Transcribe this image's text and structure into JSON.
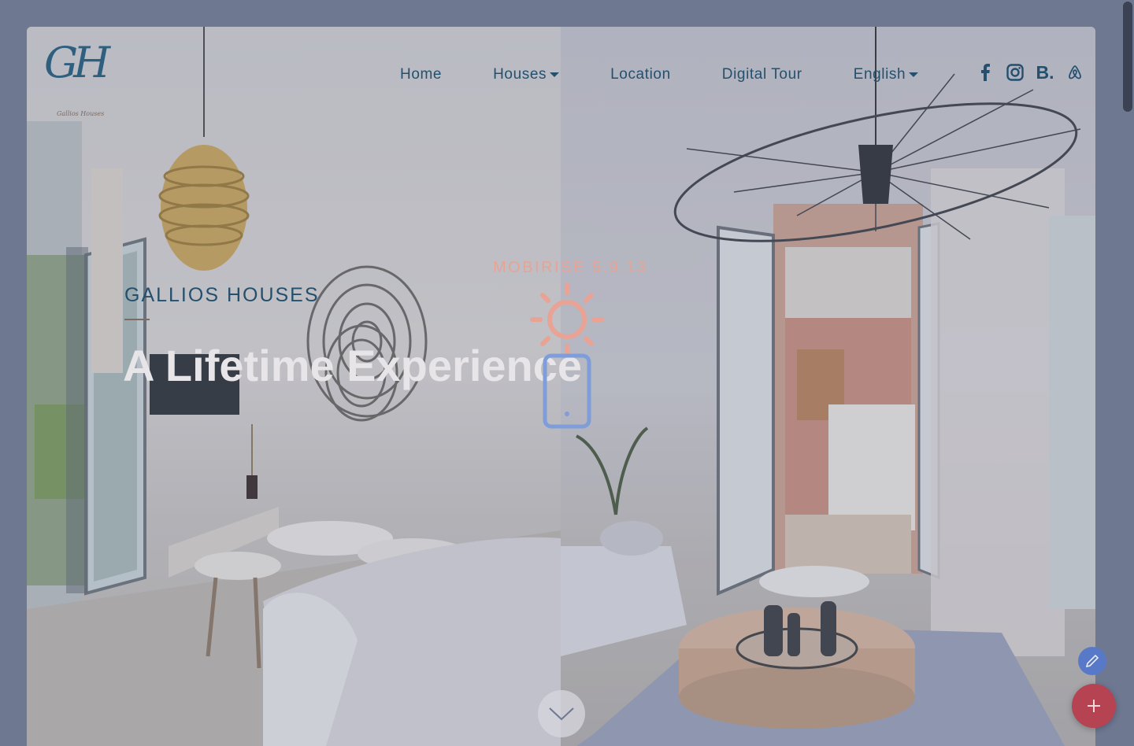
{
  "brand": {
    "mark": "GH",
    "subtitle": "Gallios Houses"
  },
  "nav": {
    "items": [
      {
        "label": "Home",
        "dropdown": false
      },
      {
        "label": "Houses",
        "dropdown": true
      },
      {
        "label": "Location",
        "dropdown": false
      },
      {
        "label": "Digital Tour",
        "dropdown": false
      },
      {
        "label": "English",
        "dropdown": true
      }
    ],
    "social": [
      "facebook-icon",
      "instagram-icon",
      "booking-icon",
      "airbnb-icon"
    ],
    "booking_text": "B."
  },
  "hero": {
    "kicker": "GALLIOS HOUSES",
    "headline": "A Lifetime Experience"
  },
  "overlay": {
    "label": "MOBIRISE  5.9.13"
  },
  "colors": {
    "nav_text": "#24506e",
    "accent_pink": "#e8a394",
    "fab_edit": "#5878c8",
    "fab_add": "#b54352"
  }
}
